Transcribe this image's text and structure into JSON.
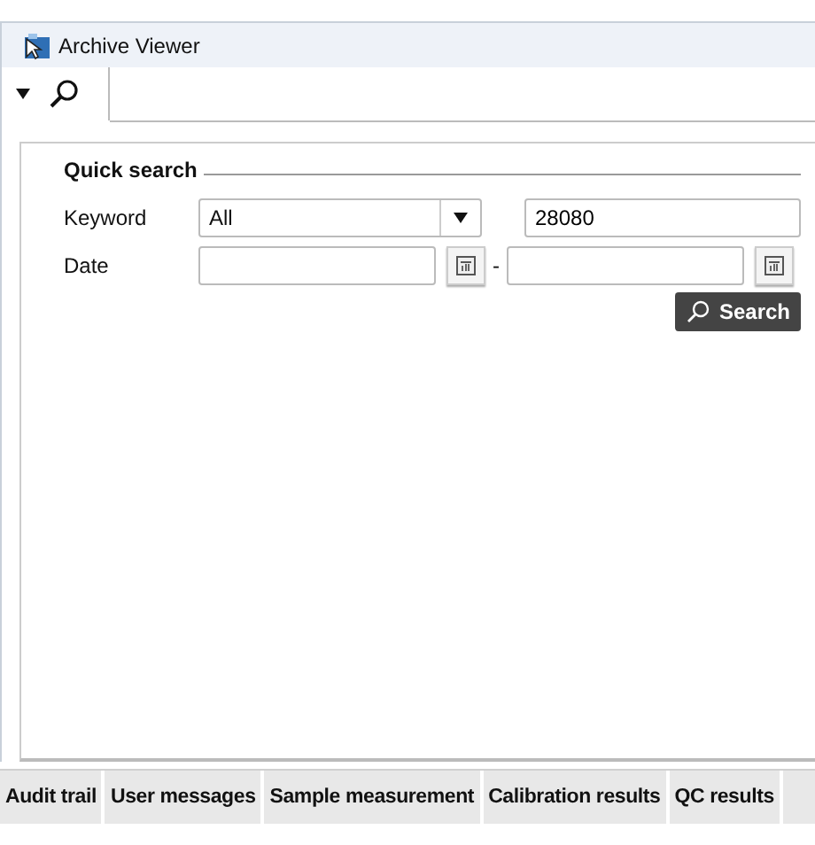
{
  "window": {
    "title": "Archive Viewer"
  },
  "toolbar": {
    "tabs": [
      {
        "kind": "search",
        "selected": true
      }
    ]
  },
  "quick_search": {
    "title": "Quick search",
    "keyword": {
      "label": "Keyword",
      "option": "All",
      "value": "28080"
    },
    "date": {
      "label": "Date",
      "separator": "-"
    },
    "search_button": "Search"
  },
  "bottom_tabs": [
    {
      "label": "Audit trail"
    },
    {
      "label": "User messages"
    },
    {
      "label": "Sample measurement"
    },
    {
      "label": "Calibration results"
    },
    {
      "label": "QC results"
    }
  ]
}
